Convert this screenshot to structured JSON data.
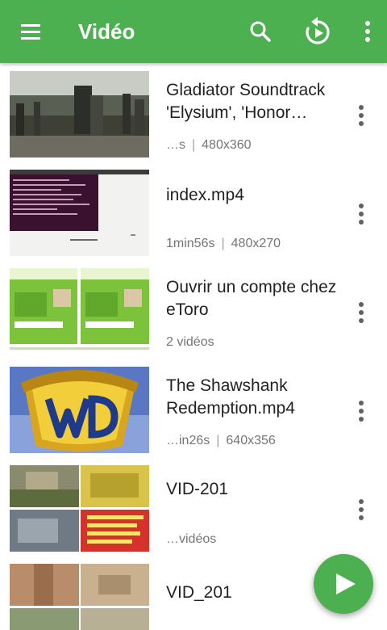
{
  "app": {
    "title": "Vidéo",
    "colors": {
      "primary": "#4caf50",
      "text": "#222222",
      "meta": "#757575"
    },
    "icons": [
      "menu-icon",
      "search-icon",
      "resume-icon",
      "overflow-icon",
      "more-icon",
      "play-icon"
    ]
  },
  "videos": [
    {
      "title": "Gladiator Soundtrack 'Elysium', 'Honor Him',…",
      "duration": "…s",
      "resolution": "480x360"
    },
    {
      "title": "index.mp4",
      "duration": "1min56s",
      "resolution": "480x270"
    },
    {
      "title": "Ouvrir un compte chez eToro",
      "duration": "",
      "resolution": "",
      "count": "2 vidéos"
    },
    {
      "title": "The Shawshank Redemption.mp4",
      "duration": "…in26s",
      "resolution": "640x356"
    },
    {
      "title": "VID-201",
      "duration": "",
      "resolution": "",
      "count": "…vidéos"
    },
    {
      "title": "VID_201"
    }
  ]
}
